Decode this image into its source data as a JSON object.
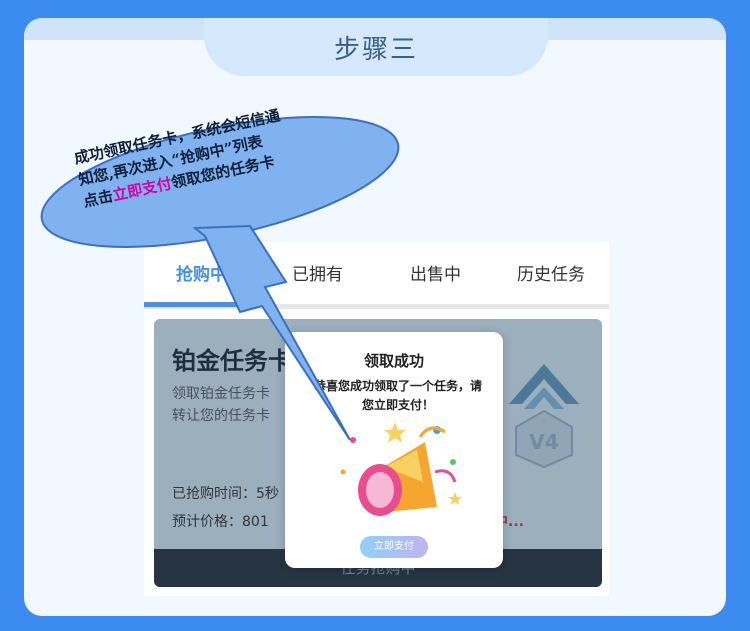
{
  "header": {
    "title": "步骤三"
  },
  "tabs": [
    {
      "label": "抢购中",
      "active": true
    },
    {
      "label": "已拥有",
      "active": false
    },
    {
      "label": "出售中",
      "active": false
    },
    {
      "label": "历史任务",
      "active": false
    }
  ],
  "product": {
    "name": "铂金任务卡",
    "desc_line1": "领取铂金任务卡",
    "desc_line2": "转让您的任务卡",
    "time": "已抢购时间：5秒",
    "price": "预计价格：801",
    "status": "中...",
    "button": "任务抢购中",
    "badge_label": "V4"
  },
  "modal": {
    "title": "领取成功",
    "text": "恭喜您成功领取了一个任务，请您立即支付！",
    "button": "立即支付"
  },
  "callout": {
    "line1": "成功领取任务卡，系统会短信通",
    "line2": "知您,再次进入“抢购中”列表",
    "line3_prefix": "点击",
    "line3_highlight": "立即支付",
    "line3_suffix": "领取您的任务卡"
  },
  "colors": {
    "background": "#3b8bf0",
    "accent": "#4a90e2",
    "highlight": "#d400a8"
  }
}
